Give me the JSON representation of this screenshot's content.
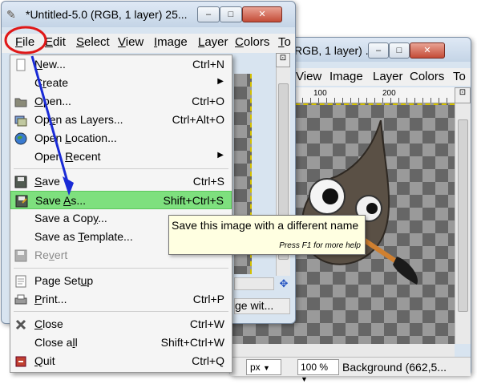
{
  "back_window": {
    "title": "RGB, 1 layer) ...",
    "menubar": [
      "View",
      "Image",
      "Layer",
      "Colors",
      "To"
    ],
    "ruler_ticks": [
      "100",
      "200"
    ],
    "status": {
      "unit": "px",
      "zoom": "100 %",
      "layer_info": "Background (662,5..."
    }
  },
  "front_window": {
    "title": "*Untitled-5.0 (RGB, 1 layer) 25...",
    "menubar": [
      {
        "pre": "",
        "u": "F",
        "post": "ile"
      },
      {
        "pre": "",
        "u": "E",
        "post": "dit"
      },
      {
        "pre": "",
        "u": "S",
        "post": "elect"
      },
      {
        "pre": "",
        "u": "V",
        "post": "iew"
      },
      {
        "pre": "",
        "u": "I",
        "post": "mage"
      },
      {
        "pre": "",
        "u": "L",
        "post": "ayer"
      },
      {
        "pre": "",
        "u": "C",
        "post": "olors"
      },
      {
        "pre": "",
        "u": "T",
        "post": "o"
      }
    ],
    "status_fragment": "ge wit...",
    "title_buttons": {
      "minimize": "–",
      "maximize": "□",
      "close": "✕"
    }
  },
  "file_menu": {
    "items": [
      {
        "pre": "",
        "u": "N",
        "post": "ew...",
        "shortcut": "Ctrl+N",
        "icon": "new-image-icon"
      },
      {
        "pre": "C",
        "u": "r",
        "post": "eate",
        "submenu": true
      },
      {
        "pre": "",
        "u": "O",
        "post": "pen...",
        "shortcut": "Ctrl+O",
        "icon": "open-folder-icon"
      },
      {
        "pre": "Op",
        "u": "e",
        "post": "n as Layers...",
        "shortcut": "Ctrl+Alt+O",
        "icon": "open-layers-icon"
      },
      {
        "pre": "Open ",
        "u": "L",
        "post": "ocation...",
        "icon": "globe-icon"
      },
      {
        "pre": "Open ",
        "u": "R",
        "post": "ecent",
        "submenu": true
      },
      {
        "pre": "",
        "u": "S",
        "post": "ave",
        "shortcut": "Ctrl+S",
        "icon": "save-icon"
      },
      {
        "pre": "Save ",
        "u": "A",
        "post": "s...",
        "shortcut": "Shift+Ctrl+S",
        "icon": "save-as-icon"
      },
      {
        "pre": "Save a Cop",
        "u": "y",
        "post": "...",
        "shortcut": ""
      },
      {
        "pre": "Save as ",
        "u": "T",
        "post": "emplate...",
        "shortcut": ""
      },
      {
        "pre": "Re",
        "u": "v",
        "post": "ert",
        "icon": "revert-icon"
      },
      {
        "pre": "Page Set",
        "u": "u",
        "post": "p",
        "icon": "page-setup-icon"
      },
      {
        "pre": "",
        "u": "P",
        "post": "rint...",
        "shortcut": "Ctrl+P",
        "icon": "print-icon"
      },
      {
        "pre": "",
        "u": "C",
        "post": "lose",
        "shortcut": "Ctrl+W",
        "icon": "close-image-icon"
      },
      {
        "pre": "Close a",
        "u": "l",
        "post": "l",
        "shortcut": "Shift+Ctrl+W"
      },
      {
        "pre": "",
        "u": "Q",
        "post": "uit",
        "shortcut": "Ctrl+Q",
        "icon": "quit-icon"
      }
    ]
  },
  "tooltip": {
    "text": "Save this image with a different name",
    "hint": "Press F1 for more help"
  },
  "colors": {
    "highlight": "#7ee07e",
    "annotation_red": "#e01818",
    "annotation_blue": "#1a2bd6",
    "tooltip_bg": "#ffffe1"
  }
}
